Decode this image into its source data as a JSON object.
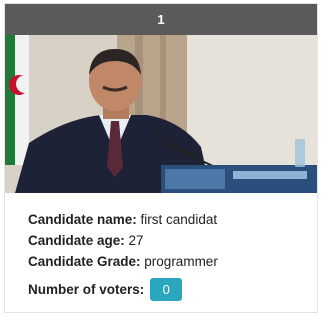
{
  "card": {
    "index": "1",
    "photo_alt": "Candidate photo",
    "name_label": "Candidate name:",
    "name_value": "first candidat",
    "age_label": "Candidate age:",
    "age_value": "27",
    "grade_label": "Candidate Grade:",
    "grade_value": "programmer",
    "voters_label": "Number of voters:",
    "voters_value": "0"
  },
  "colors": {
    "header_bg": "#5a5a5a",
    "vote_button": "#2aa6bd"
  }
}
